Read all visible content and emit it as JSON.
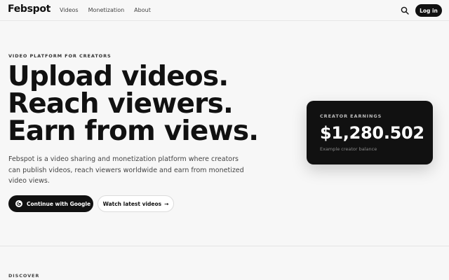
{
  "header": {
    "logo": "Febspot",
    "nav": [
      "Videos",
      "Monetization",
      "About"
    ],
    "login_label": "Log in",
    "search_icon": "search-icon"
  },
  "hero": {
    "eyebrow": "VIDEO PLATFORM FOR CREATORS",
    "headline": [
      "Upload videos.",
      "Reach viewers.",
      "Earn from views."
    ],
    "description": "Febspot is a video sharing and monetization platform where creators can publish videos, reach viewers worldwide and earn from monetized video views.",
    "google_button": "Continue with Google",
    "watch_button": "Watch latest videos",
    "watch_arrow": "→"
  },
  "earnings_card": {
    "label": "CREATOR EARNINGS",
    "amount": "$1,280.502",
    "sublabel": "Example creator balance"
  },
  "discover": {
    "label": "DISCOVER"
  },
  "colors": {
    "background": "#f7f7f7",
    "primary": "#111111",
    "text_muted": "#444444"
  }
}
